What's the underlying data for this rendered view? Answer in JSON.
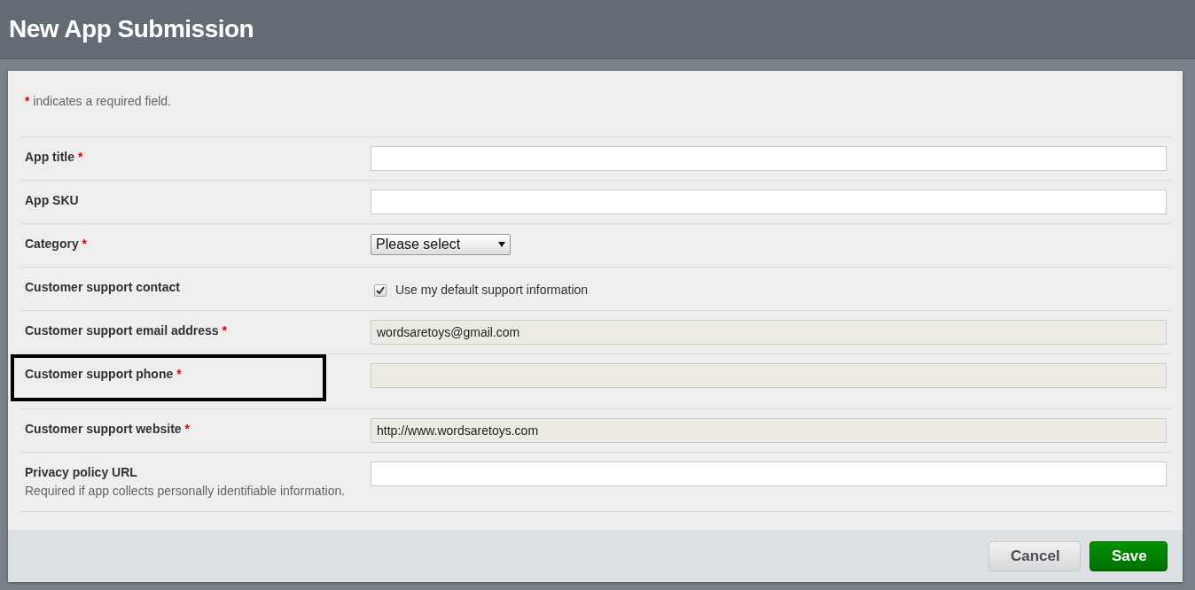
{
  "header": {
    "title": "New App Submission"
  },
  "note": {
    "mark": "*",
    "text": "indicates a required field."
  },
  "fields": [
    {
      "kind": "text",
      "label": "App title",
      "required_mark": "*",
      "disabled": false,
      "highlighted": false
    },
    {
      "kind": "text",
      "label": "App SKU",
      "disabled": false,
      "highlighted": false
    },
    {
      "kind": "select",
      "label": "Category",
      "required_mark": "*",
      "value": "Please select",
      "highlighted": false
    },
    {
      "kind": "checkbox",
      "label": "Customer support contact",
      "checked": true,
      "option": "Use my default support information",
      "highlighted": false
    },
    {
      "kind": "text",
      "label": "Customer support email address",
      "required_mark": "*",
      "disabled": true,
      "value": "wordsaretoys@gmail.com",
      "highlighted": false
    },
    {
      "kind": "text",
      "label": "Customer support phone",
      "required_mark": "*",
      "disabled": true,
      "highlighted": true
    },
    {
      "kind": "text",
      "label": "Customer support website",
      "required_mark": "*",
      "disabled": true,
      "value": "http://www.wordsaretoys.com",
      "highlighted": false
    },
    {
      "kind": "text",
      "label": "Privacy policy URL",
      "hint": "Required if app collects personally identifiable information.",
      "disabled": false,
      "highlighted": false
    }
  ],
  "buttons": [
    {
      "kind": "secondary",
      "label": "Cancel"
    },
    {
      "kind": "primary",
      "label": "Save"
    }
  ]
}
